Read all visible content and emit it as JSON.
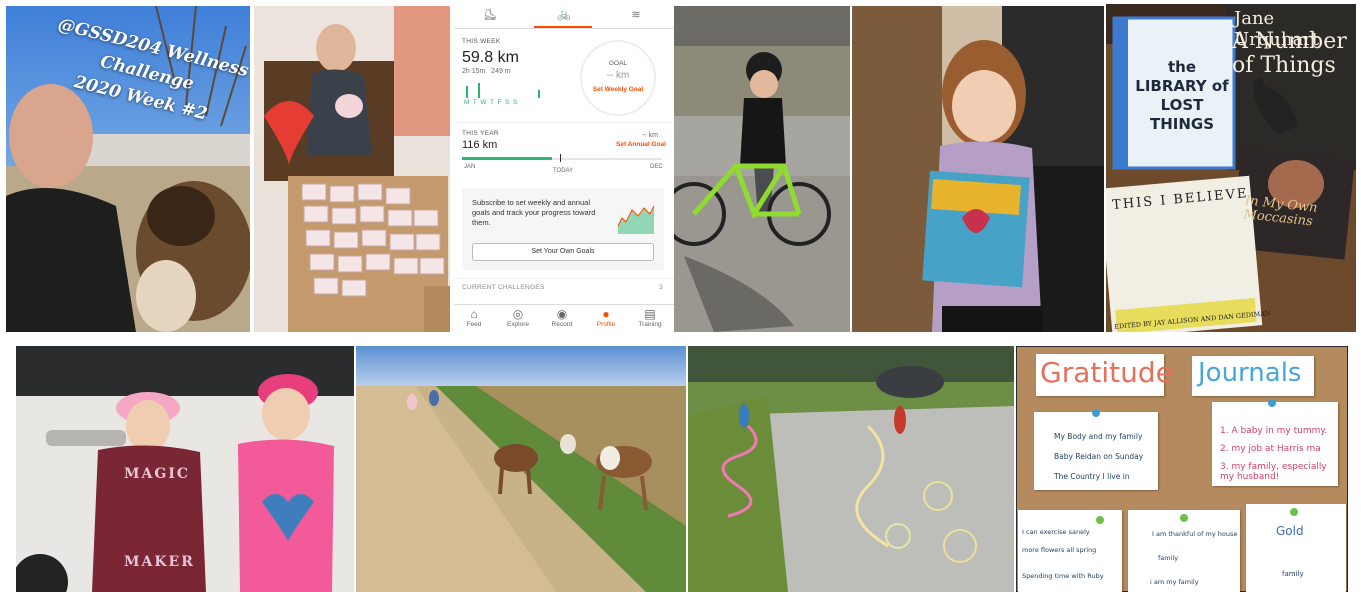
{
  "challenge_overlay": {
    "line1": "@GSSD204 Wellness Challenge",
    "line2": "2020 Week #2"
  },
  "strava": {
    "this_week_label": "THIS WEEK",
    "distance": "59.8 km",
    "time_elev": "2h 15m   249 m",
    "days": "M  T  W  T  F  S  S",
    "goal_label": "GOAL",
    "goal_value": "-- km",
    "set_weekly_goal": "Set Weekly Goal",
    "this_year_label": "THIS YEAR",
    "year_distance": "116 km",
    "year_goal": "-- km",
    "set_annual_goal": "Set Annual Goal",
    "jan": "JAN",
    "today": "TODAY",
    "dec": "DEC",
    "subscribe_text": "Subscribe to set weekly and annual goals and track your progress toward them.",
    "set_goals_button": "Set Your Own Goals",
    "current_challenges": "CURRENT CHALLENGES",
    "challenges_count": "3",
    "nav": [
      "Feed",
      "Explore",
      "Record",
      "Profile",
      "Training"
    ],
    "accent": "#fc4c02"
  },
  "books": {
    "author": "Jane Urquhart",
    "title": "A Number of Things",
    "library_title": "the LIBRARY of LOST THINGS",
    "believe": "THIS I BELIEVE",
    "believe_credit": "EDITED BY JAY ALLISON AND DAN GEDIMAN",
    "moccasins": "In My Own Moccasins"
  },
  "shirts": {
    "magic": "MAGIC",
    "maker": "MAKER"
  },
  "gratitude": {
    "heading_left": "Gratitude",
    "heading_right": "Journals",
    "note1": [
      "My Body and my family",
      "Baby Reidan on Sunday",
      "The Country I live in"
    ],
    "note2": [
      "1. A baby in my tummy.",
      "2. my job at Harris ma",
      "3. my family, especially my husband!"
    ],
    "note3": [
      "I can exercise sanely",
      "more flowers all spring",
      "Spending time with Ruby"
    ],
    "note4": [
      "I am thankful of my house",
      "family",
      "i am my family"
    ],
    "note5": [
      "Gold",
      "family"
    ]
  }
}
